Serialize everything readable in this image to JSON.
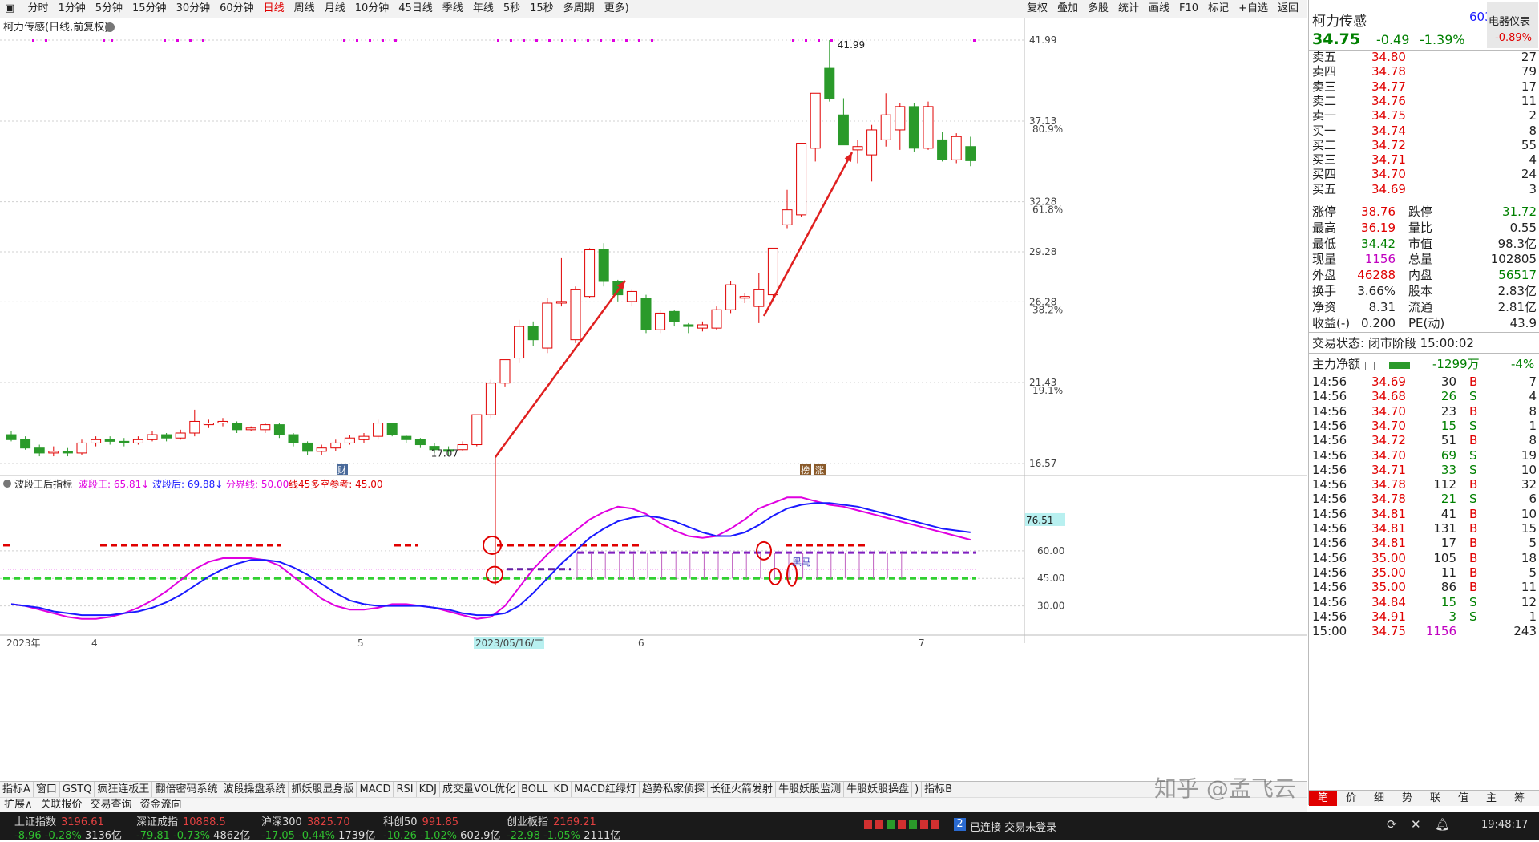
{
  "toolbar": {
    "periods": [
      "分时",
      "1分钟",
      "5分钟",
      "15分钟",
      "30分钟",
      "60分钟",
      "日线",
      "周线",
      "月线",
      "10分钟",
      "45日线",
      "季线",
      "年线",
      "5秒",
      "15秒",
      "多周期",
      "更多)"
    ],
    "active": "日线",
    "right_items": [
      "复权",
      "叠加",
      "多股",
      "统计",
      "画线",
      "F10",
      "标记",
      "+自选",
      "返回"
    ]
  },
  "chart": {
    "title": "柯力传感(日线,前复权)",
    "price_labels": [
      "41.99",
      "37.13",
      "32.28",
      "29.28",
      "26.28",
      "21.43",
      "16.57"
    ],
    "pct_labels": [
      "80.9%",
      "61.8%",
      "38.2%",
      "19.1%"
    ],
    "high_label": "41.99",
    "low_label": "17.07",
    "badges": [
      "财",
      "榜",
      "涨"
    ],
    "annotation": "黑马"
  },
  "chart_data": {
    "type": "candlestick",
    "ylim": [
      16.57,
      41.99
    ],
    "candles": [
      [
        18.3,
        18.0,
        18.5,
        17.9
      ],
      [
        18.0,
        17.5,
        18.2,
        17.4
      ],
      [
        17.5,
        17.2,
        17.7,
        17.0
      ],
      [
        17.2,
        17.3,
        17.6,
        17.0
      ],
      [
        17.3,
        17.2,
        17.5,
        17.0
      ],
      [
        17.2,
        17.8,
        18.0,
        17.1
      ],
      [
        17.8,
        18.0,
        18.2,
        17.6
      ],
      [
        18.0,
        17.9,
        18.2,
        17.7
      ],
      [
        17.9,
        17.8,
        18.1,
        17.6
      ],
      [
        17.8,
        18.0,
        18.2,
        17.7
      ],
      [
        18.0,
        18.3,
        18.5,
        17.9
      ],
      [
        18.3,
        18.1,
        18.4,
        17.9
      ],
      [
        18.1,
        18.4,
        18.6,
        18.0
      ],
      [
        18.4,
        19.1,
        19.8,
        18.2
      ],
      [
        18.9,
        19.0,
        19.2,
        18.7
      ],
      [
        19.0,
        19.1,
        19.3,
        18.8
      ],
      [
        19.0,
        18.6,
        19.1,
        18.4
      ],
      [
        18.6,
        18.7,
        18.8,
        18.5
      ],
      [
        18.6,
        18.9,
        19.0,
        18.4
      ],
      [
        18.9,
        18.3,
        19.0,
        18.1
      ],
      [
        18.3,
        17.8,
        18.4,
        17.6
      ],
      [
        17.8,
        17.3,
        17.9,
        17.1
      ],
      [
        17.3,
        17.5,
        17.7,
        17.1
      ],
      [
        17.5,
        17.8,
        18.0,
        17.3
      ],
      [
        17.8,
        18.1,
        18.3,
        17.7
      ],
      [
        18.0,
        18.2,
        18.4,
        17.8
      ],
      [
        18.2,
        19.0,
        19.2,
        18.0
      ],
      [
        19.0,
        18.3,
        19.0,
        18.2
      ],
      [
        18.2,
        18.0,
        18.3,
        17.8
      ],
      [
        18.0,
        17.7,
        18.1,
        17.5
      ],
      [
        17.6,
        17.4,
        17.8,
        17.2
      ],
      [
        17.4,
        17.3,
        17.6,
        17.07
      ],
      [
        17.4,
        17.7,
        17.9,
        17.3
      ],
      [
        17.7,
        19.5,
        19.5,
        17.6
      ],
      [
        19.5,
        21.4,
        21.6,
        19.3
      ],
      [
        21.4,
        22.8,
        22.8,
        21.2
      ],
      [
        22.9,
        24.8,
        25.2,
        22.6
      ],
      [
        24.8,
        24.0,
        25.1,
        23.6
      ],
      [
        23.5,
        26.2,
        26.5,
        23.2
      ],
      [
        26.2,
        26.3,
        28.9,
        26.0
      ],
      [
        24.0,
        27.0,
        27.2,
        23.8
      ],
      [
        26.6,
        29.4,
        29.5,
        26.5
      ],
      [
        29.4,
        27.5,
        29.8,
        27.2
      ],
      [
        27.5,
        26.7,
        27.6,
        26.3
      ],
      [
        26.3,
        26.9,
        27.0,
        26.0
      ],
      [
        26.5,
        24.6,
        26.7,
        24.4
      ],
      [
        24.6,
        25.6,
        25.8,
        24.4
      ],
      [
        25.7,
        25.1,
        25.8,
        24.8
      ],
      [
        24.9,
        24.8,
        25.0,
        24.4
      ],
      [
        24.7,
        24.9,
        25.1,
        24.5
      ],
      [
        24.7,
        25.8,
        26.0,
        24.6
      ],
      [
        25.8,
        27.3,
        27.5,
        25.6
      ],
      [
        26.5,
        26.6,
        26.8,
        26.2
      ],
      [
        26.0,
        27.0,
        28.0,
        25.0
      ],
      [
        26.7,
        29.5,
        29.5,
        26.5
      ],
      [
        30.9,
        31.8,
        33.0,
        30.7
      ],
      [
        31.5,
        35.8,
        35.8,
        31.4
      ],
      [
        35.5,
        38.8,
        38.8,
        34.7
      ],
      [
        40.3,
        38.5,
        41.99,
        38.3
      ],
      [
        37.5,
        35.7,
        38.5,
        35.7
      ],
      [
        35.4,
        35.6,
        36.0,
        34.6
      ],
      [
        35.1,
        36.6,
        36.9,
        33.5
      ],
      [
        36.0,
        37.5,
        38.8,
        35.6
      ],
      [
        36.6,
        38.0,
        38.2,
        35.4
      ],
      [
        38.0,
        35.5,
        38.2,
        35.3
      ],
      [
        35.5,
        38.0,
        38.3,
        35.4
      ],
      [
        36.0,
        34.8,
        36.5,
        34.7
      ],
      [
        34.8,
        36.2,
        36.4,
        34.6
      ],
      [
        35.6,
        34.75,
        36.19,
        34.42
      ]
    ],
    "x_labels": [
      "2023年",
      "4",
      "5",
      "2023/05/16/二",
      "6",
      "7"
    ]
  },
  "indicator": {
    "name": "波段王后指标",
    "legend": [
      {
        "text": "波段王: 65.81↓",
        "color": "#e000e0"
      },
      {
        "text": "波段后: 69.88↓",
        "color": "#1a1aff"
      },
      {
        "text": "分界线: 50.00",
        "color": "#e000e0"
      },
      {
        "text": "线45多空参考: 45.00",
        "color": "#e00000"
      }
    ],
    "y_labels": [
      "60.00",
      "45.00",
      "30.00"
    ],
    "current_label": "76.51",
    "ylim": [
      22,
      90
    ],
    "wang": [
      31,
      30,
      28,
      26,
      24,
      23,
      23,
      24,
      26,
      29,
      33,
      38,
      44,
      50,
      54,
      56,
      56,
      56,
      55,
      52,
      46,
      40,
      34,
      30,
      28,
      28,
      29,
      31,
      31,
      30,
      29,
      27,
      25,
      23,
      24,
      30,
      40,
      50,
      58,
      65,
      71,
      77,
      81,
      84,
      83,
      80,
      75,
      71,
      68,
      67,
      68,
      72,
      77,
      83,
      86,
      89,
      89,
      87,
      85,
      84,
      82,
      80,
      78,
      76,
      74,
      72,
      70,
      68,
      66
    ],
    "hou": [
      31,
      30,
      29,
      27,
      26,
      25,
      25,
      25,
      26,
      27,
      29,
      32,
      36,
      41,
      46,
      50,
      53,
      55,
      55,
      54,
      51,
      47,
      42,
      37,
      33,
      31,
      30,
      30,
      30,
      30,
      29,
      28,
      26,
      25,
      25,
      26,
      30,
      37,
      45,
      53,
      60,
      67,
      72,
      76,
      78,
      79,
      78,
      76,
      73,
      70,
      68,
      68,
      70,
      74,
      79,
      83,
      85,
      86,
      86,
      85,
      84,
      82,
      80,
      78,
      76,
      74,
      72,
      71,
      70
    ]
  },
  "bottom_tabs": [
    "指标A",
    "窗口",
    "GSTQ",
    "疯狂连板王",
    "翻倍密码系统",
    "波段操盘系统",
    "抓妖股显身版",
    "MACD",
    "RSI",
    "KDJ",
    "成交量VOL优化",
    "BOLL",
    "KD",
    "MACD红绿灯",
    "趋势私家侦探",
    "长征火箭发射",
    "牛股妖股监测",
    "牛股妖股操盘",
    ")",
    "指标B"
  ],
  "bottom_tabs2": [
    "扩展∧",
    "关联报价",
    "交易查询",
    "资金流向"
  ],
  "quote": {
    "name": "柯力传感",
    "code": "603",
    "badge": "电器仪表",
    "badge_pct": "-0.89%",
    "price": "34.75",
    "change": "-0.49",
    "change_pct": "-1.39%",
    "sells": [
      [
        "卖五",
        "34.80",
        "27"
      ],
      [
        "卖四",
        "34.78",
        "79"
      ],
      [
        "卖三",
        "34.77",
        "17"
      ],
      [
        "卖二",
        "34.76",
        "11"
      ],
      [
        "卖一",
        "34.75",
        "2"
      ]
    ],
    "buys": [
      [
        "买一",
        "34.74",
        "8"
      ],
      [
        "买二",
        "34.72",
        "55"
      ],
      [
        "买三",
        "34.71",
        "4"
      ],
      [
        "买四",
        "34.70",
        "24"
      ],
      [
        "买五",
        "34.69",
        "3"
      ]
    ],
    "stats": [
      [
        "涨停",
        "38.76",
        "跌停",
        "31.72"
      ],
      [
        "最高",
        "36.19",
        "量比",
        "0.55"
      ],
      [
        "最低",
        "34.42",
        "市值",
        "98.3亿"
      ],
      [
        "现量",
        "1156",
        "总量",
        "102805"
      ],
      [
        "外盘",
        "46288",
        "内盘",
        "56517"
      ],
      [
        "换手",
        "3.66%",
        "股本",
        "2.83亿"
      ],
      [
        "净资",
        "8.31",
        "流通",
        "2.81亿"
      ],
      [
        "收益(-)",
        "0.200",
        "PE(动)",
        "43.9"
      ]
    ],
    "trade_state": "交易状态: 闭市阶段 15:00:02",
    "main_flow_label": "主力净额",
    "main_flow_value": "-1299万",
    "main_flow_pct": "-4%",
    "ticks": [
      [
        "14:56",
        "34.69",
        "30",
        "B",
        "7"
      ],
      [
        "14:56",
        "34.68",
        "26",
        "S",
        "4"
      ],
      [
        "14:56",
        "34.70",
        "23",
        "B",
        "8"
      ],
      [
        "14:56",
        "34.70",
        "15",
        "S",
        "1"
      ],
      [
        "14:56",
        "34.72",
        "51",
        "B",
        "8"
      ],
      [
        "14:56",
        "34.70",
        "69",
        "S",
        "19"
      ],
      [
        "14:56",
        "34.71",
        "33",
        "S",
        "10"
      ],
      [
        "14:56",
        "34.78",
        "112",
        "B",
        "32"
      ],
      [
        "14:56",
        "34.78",
        "21",
        "S",
        "6"
      ],
      [
        "14:56",
        "34.81",
        "41",
        "B",
        "10"
      ],
      [
        "14:56",
        "34.81",
        "131",
        "B",
        "15"
      ],
      [
        "14:56",
        "34.81",
        "17",
        "B",
        "5"
      ],
      [
        "14:56",
        "35.00",
        "105",
        "B",
        "18"
      ],
      [
        "14:56",
        "35.00",
        "11",
        "B",
        "5"
      ],
      [
        "14:56",
        "35.00",
        "86",
        "B",
        "11"
      ],
      [
        "14:56",
        "34.84",
        "15",
        "S",
        "12"
      ],
      [
        "14:56",
        "34.91",
        "3",
        "S",
        "1"
      ],
      [
        "15:00",
        "34.75",
        "1156",
        "",
        "243"
      ]
    ],
    "bottom_tabs": [
      "笔",
      "价",
      "细",
      "势",
      "联",
      "值",
      "主",
      "筹"
    ]
  },
  "status": {
    "indices": [
      {
        "name": "上证指数",
        "val": "3196.61",
        "chg": "-8.96",
        "pct": "-0.28%",
        "amt": "3136亿"
      },
      {
        "name": "深证成指",
        "val": "10888.5",
        "chg": "-79.81",
        "pct": "-0.73%",
        "amt": "4862亿"
      },
      {
        "name": "沪深300",
        "val": "3825.70",
        "chg": "-17.05",
        "pct": "-0.44%",
        "amt": "1739亿"
      },
      {
        "name": "科创50",
        "val": "991.85",
        "chg": "-10.26",
        "pct": "-1.02%",
        "amt": "602.9亿"
      },
      {
        "name": "创业板指",
        "val": "2169.21",
        "chg": "-22.98",
        "pct": "-1.05%",
        "amt": "2111亿"
      }
    ],
    "connection": "已连接 交易未登录",
    "conn_num": "2",
    "time": "19:48:17",
    "watermark": "知乎 @孟飞云"
  },
  "colors": {
    "up": "#e00000",
    "down": "#2a9a2a",
    "wang": "#e000e0",
    "hou": "#1a1aff"
  }
}
